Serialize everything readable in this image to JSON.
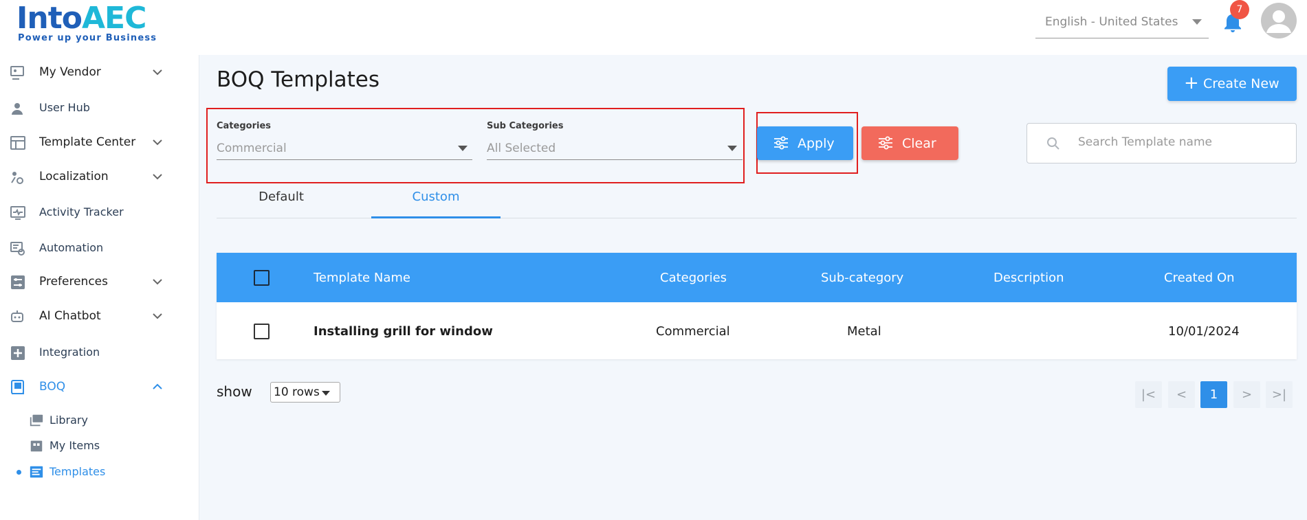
{
  "brand": {
    "name_part1": "Into",
    "name_part2": "AEC",
    "tagline": "Power up your Business"
  },
  "header": {
    "language": "English - United States",
    "notification_count": "7"
  },
  "sidebar": {
    "items": [
      {
        "label": "My Vendor",
        "expandable": true,
        "icon": "vendor-icon"
      },
      {
        "label": "User Hub",
        "expandable": false,
        "icon": "user-icon"
      },
      {
        "label": "Template Center",
        "expandable": true,
        "icon": "template-center-icon"
      },
      {
        "label": "Localization",
        "expandable": true,
        "icon": "localization-icon"
      },
      {
        "label": "Activity Tracker",
        "expandable": false,
        "icon": "activity-icon"
      },
      {
        "label": "Automation",
        "expandable": false,
        "icon": "automation-icon"
      },
      {
        "label": "Preferences",
        "expandable": true,
        "icon": "preferences-icon"
      },
      {
        "label": "AI Chatbot",
        "expandable": true,
        "icon": "chatbot-icon"
      },
      {
        "label": "Integration",
        "expandable": false,
        "icon": "integration-icon"
      },
      {
        "label": "BOQ",
        "expandable": true,
        "expanded": true,
        "icon": "boq-icon"
      }
    ],
    "boq_children": [
      {
        "label": "Library",
        "icon": "library-icon"
      },
      {
        "label": "My Items",
        "icon": "items-icon"
      },
      {
        "label": "Templates",
        "icon": "templates-icon",
        "active": true
      }
    ]
  },
  "main": {
    "title": "BOQ Templates",
    "create_button": "Create New",
    "filters": {
      "categories_label": "Categories",
      "categories_value": "Commercial",
      "sub_categories_label": "Sub Categories",
      "sub_categories_value": "All Selected"
    },
    "apply_button": "Apply",
    "clear_button": "Clear",
    "search_placeholder": "Search Template name",
    "tabs": [
      {
        "label": "Default",
        "active": false
      },
      {
        "label": "Custom",
        "active": true
      }
    ],
    "table": {
      "columns": [
        "Template Name",
        "Categories",
        "Sub-category",
        "Description",
        "Created On"
      ],
      "rows": [
        {
          "name": "Installing grill for window",
          "category": "Commercial",
          "sub_category": "Metal",
          "description": "",
          "created_on": "10/01/2024"
        }
      ]
    },
    "pagination": {
      "show_label": "show",
      "rows_per_page": "10 rows",
      "current_page": "1"
    }
  },
  "colors": {
    "primary": "#3a9df5",
    "danger": "#f26a5c",
    "highlight_border": "#e01e1e",
    "active_text": "#2f8fe8"
  }
}
